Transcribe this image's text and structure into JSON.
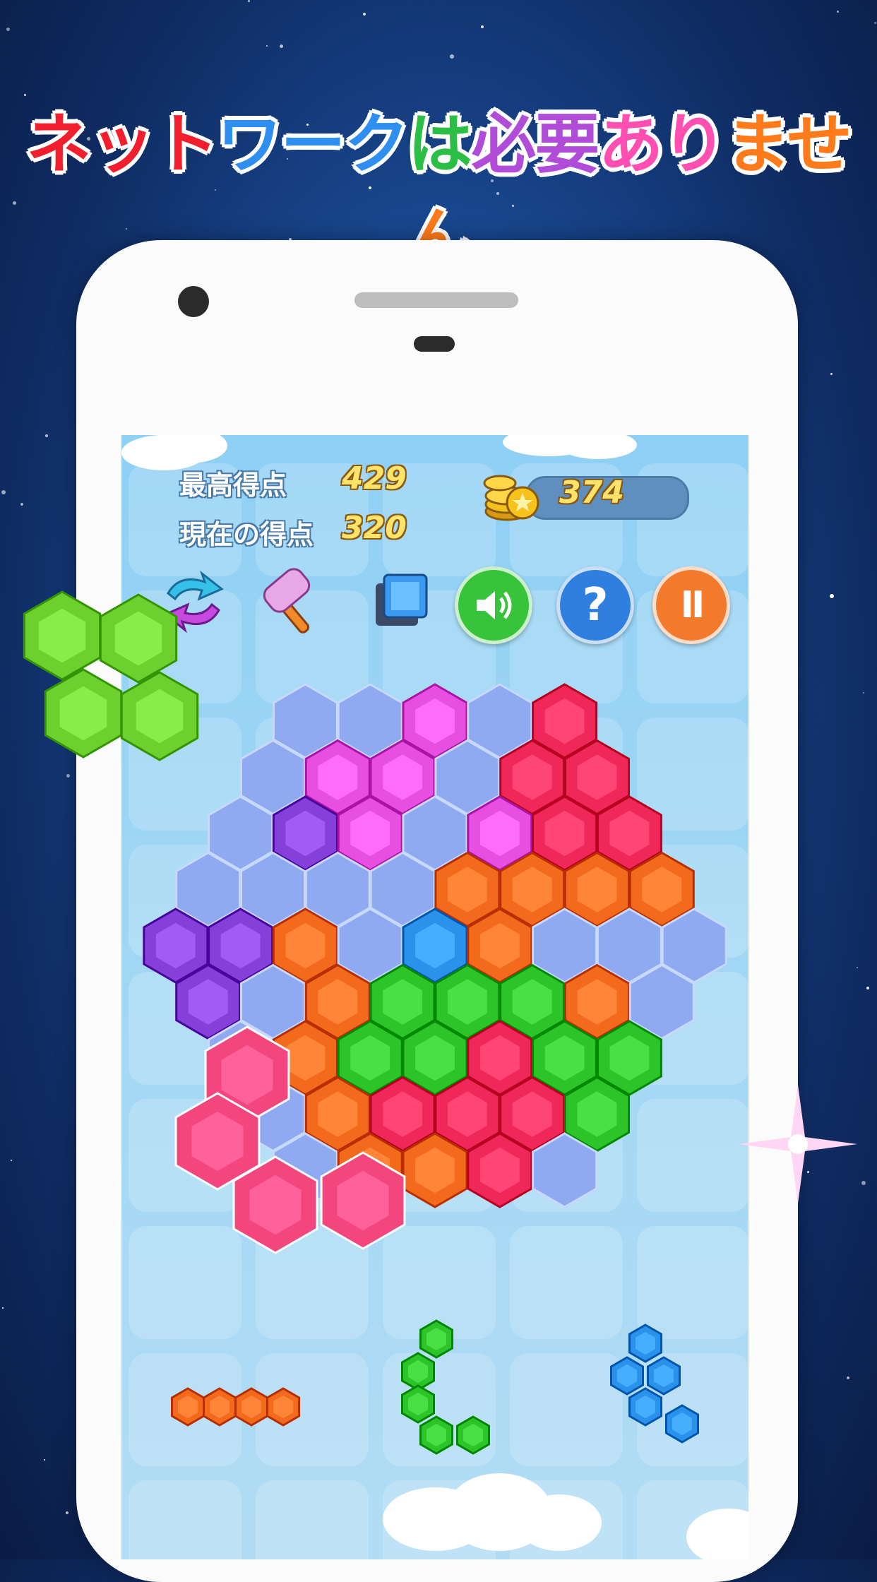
{
  "headline": {
    "segments": [
      {
        "text": "ネット",
        "color": "#f11f2d"
      },
      {
        "text": "ワーク",
        "color": "#2f8ff0"
      },
      {
        "text": "は",
        "color": "#2bbf45"
      },
      {
        "text": "必要",
        "color": "#b04cd8"
      },
      {
        "text": "あり",
        "color": "#ff4fb0"
      },
      {
        "text": "ません",
        "color": "#ff7a1a"
      }
    ]
  },
  "hud": {
    "best_label": "最高得点",
    "best_value": "429",
    "current_label": "現在の得点",
    "current_value": "320",
    "coins": "374"
  },
  "toolbar": {
    "tools": [
      "swap-icon",
      "hammer-icon",
      "single-block-icon"
    ],
    "buttons": [
      {
        "name": "sound-button",
        "icon": "speaker-icon",
        "color": "#37c43a"
      },
      {
        "name": "help-button",
        "icon": "question-icon",
        "glyph": "?",
        "color": "#2f7fe0"
      },
      {
        "name": "pause-button",
        "icon": "pause-icon",
        "glyph": "II",
        "color": "#f27a2a"
      }
    ]
  },
  "board": {
    "colors": {
      "E": "#8faaf0",
      "M": "#e64fe0",
      "R": "#f0285a",
      "O": "#f46a1c",
      "P": "#8440d8",
      "B": "#2a92ea",
      "G": "#2dc42a"
    },
    "rows": [
      "EEMER",
      "EMMERR",
      "EPMEMRR",
      "EEEEOOOO",
      "PPOEBOEEE",
      "PEOGGGOE",
      "EOGGRGG",
      "EORRRG",
      "EOORE"
    ]
  },
  "dragged_piece": {
    "color": "#f3457e",
    "cells": 4
  },
  "tray": [
    {
      "name": "orange-line-piece",
      "color": "#f46a1c",
      "cells": 4
    },
    {
      "name": "green-piece",
      "color": "#2dc42a",
      "cells": 5
    },
    {
      "name": "blue-piece",
      "color": "#2a92ea",
      "cells": 5
    }
  ],
  "decor_piece": {
    "color": "#6ed02e",
    "cells": 4
  }
}
